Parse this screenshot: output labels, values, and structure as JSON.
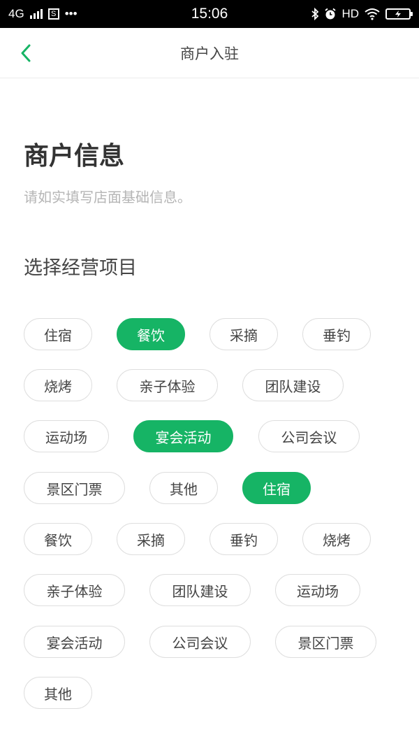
{
  "status_bar": {
    "network": "4G",
    "sim_label": "S",
    "more": "•••",
    "time": "15:06",
    "hd": "HD",
    "battery_icon": "battery-charging-icon"
  },
  "nav": {
    "title": "商户入驻",
    "back_icon": "chevron-left-icon",
    "accent": "#16b465"
  },
  "header": {
    "title": "商户信息",
    "subtitle": "请如实填写店面基础信息。"
  },
  "section": {
    "title": "选择经营项目"
  },
  "tags": [
    {
      "label": "住宿",
      "selected": false
    },
    {
      "label": "餐饮",
      "selected": true
    },
    {
      "label": "采摘",
      "selected": false
    },
    {
      "label": "垂钓",
      "selected": false
    },
    {
      "label": "烧烤",
      "selected": false
    },
    {
      "label": "亲子体验",
      "selected": false
    },
    {
      "label": "团队建设",
      "selected": false
    },
    {
      "label": "运动场",
      "selected": false
    },
    {
      "label": "宴会活动",
      "selected": true
    },
    {
      "label": "公司会议",
      "selected": false
    },
    {
      "label": "景区门票",
      "selected": false
    },
    {
      "label": "其他",
      "selected": false
    },
    {
      "label": "住宿",
      "selected": true
    },
    {
      "label": "餐饮",
      "selected": false
    },
    {
      "label": "采摘",
      "selected": false
    },
    {
      "label": "垂钓",
      "selected": false
    },
    {
      "label": "烧烤",
      "selected": false
    },
    {
      "label": "亲子体验",
      "selected": false
    },
    {
      "label": "团队建设",
      "selected": false
    },
    {
      "label": "运动场",
      "selected": false
    },
    {
      "label": "宴会活动",
      "selected": false
    },
    {
      "label": "公司会议",
      "selected": false
    },
    {
      "label": "景区门票",
      "selected": false
    },
    {
      "label": "其他",
      "selected": false
    }
  ],
  "colors": {
    "selected_bg": "#16b465",
    "tag_border": "#dedede",
    "subtitle": "#b5b5b5"
  }
}
